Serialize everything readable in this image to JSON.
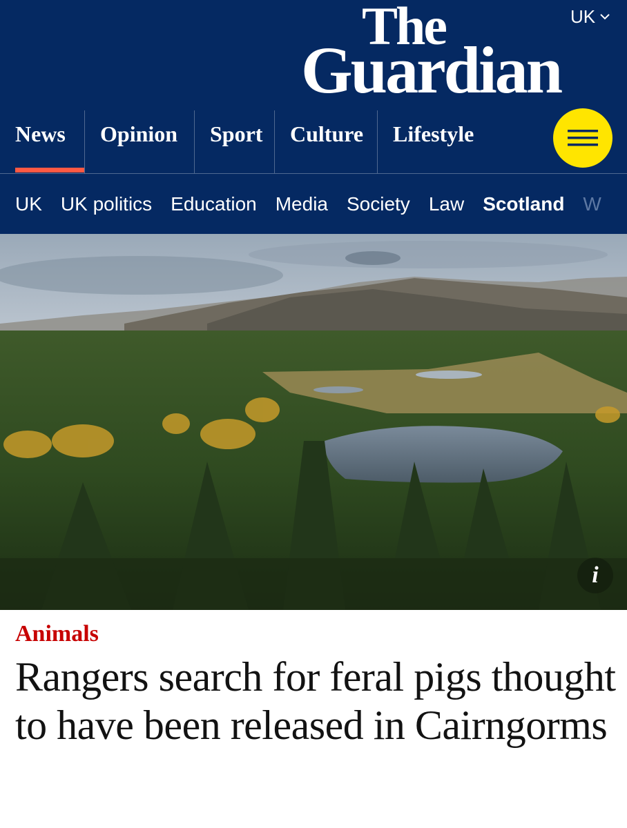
{
  "header": {
    "edition": "UK",
    "logo_line1": "The",
    "logo_line2": "Guardian",
    "background_color": "#052962",
    "accent_color": "#ff5943",
    "menu_color": "#ffe500"
  },
  "pillars": [
    {
      "label": "News",
      "active": true
    },
    {
      "label": "Opinion",
      "active": false
    },
    {
      "label": "Sport",
      "active": false
    },
    {
      "label": "Culture",
      "active": false
    },
    {
      "label": "Lifestyle",
      "active": false
    }
  ],
  "menu_icon": "hamburger-icon",
  "subnav": [
    {
      "label": "UK"
    },
    {
      "label": "UK politics"
    },
    {
      "label": "Education"
    },
    {
      "label": "Media"
    },
    {
      "label": "Society"
    },
    {
      "label": "Law"
    },
    {
      "label": "Scotland",
      "active": true
    },
    {
      "label": "W"
    }
  ],
  "hero": {
    "info_label": "i"
  },
  "article": {
    "kicker": "Animals",
    "kicker_color": "#c70000",
    "headline": "Rangers search for feral pigs thought to have been released in Cairngorms"
  }
}
